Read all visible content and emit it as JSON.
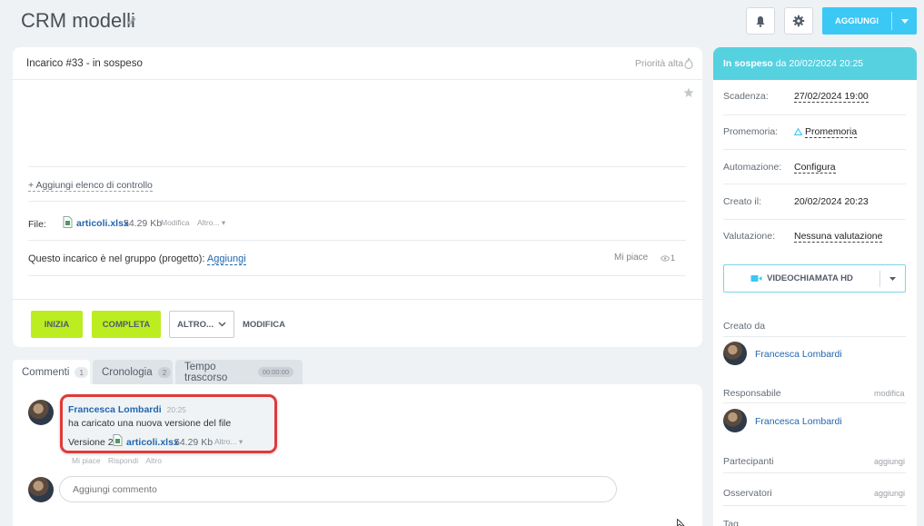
{
  "header": {
    "title": "CRM modelli",
    "add_label": "AGGIUNGI"
  },
  "task": {
    "title": "Incarico #33 - in sospeso",
    "priority_label": "Priorità alta",
    "checklist_link": "+ Aggiungi elenco di controllo",
    "file_label": "File:",
    "file_name": "articoli.xlsx",
    "file_size": "54.29 Kb",
    "file_edit": "Modifica",
    "file_more": "Altro...",
    "group_text": "Questo incarico è nel gruppo (progetto):",
    "group_link": "Aggiungi",
    "like_label": "Mi piace",
    "views": "1"
  },
  "actions": {
    "start": "INIZIA",
    "complete": "COMPLETA",
    "more": "ALTRO...",
    "edit": "MODIFICA"
  },
  "tabs": [
    {
      "label": "Commenti",
      "count": "1"
    },
    {
      "label": "Cronologia",
      "count": "2"
    },
    {
      "label": "Tempo trascorso",
      "count": "00:00:00"
    }
  ],
  "comment": {
    "author": "Francesca Lombardi",
    "time": "20:25",
    "text": "ha caricato una nuova versione del file",
    "version_label": "Versione 2:",
    "file_name": "articoli.xlsx",
    "file_size": "54.29 Kb",
    "file_more": "Altro...",
    "like": "Mi piace",
    "reply": "Rispondi",
    "more": "Altro"
  },
  "comment_input": {
    "placeholder": "Aggiungi commento"
  },
  "sidebar": {
    "status_prefix": "In sospeso",
    "status_date": "da 20/02/2024 20:25",
    "deadline_label": "Scadenza:",
    "deadline_value": "27/02/2024 19:00",
    "reminder_label": "Promemoria:",
    "reminder_value": "Promemoria",
    "automation_label": "Automazione:",
    "automation_value": "Configura",
    "created_label": "Creato il:",
    "created_value": "20/02/2024 20:23",
    "rating_label": "Valutazione:",
    "rating_value": "Nessuna valutazione",
    "video_call": "VIDEOCHIAMATA HD",
    "created_by_label": "Creato da",
    "created_by": "Francesca Lombardi",
    "responsible_label": "Responsabile",
    "responsible_action": "modifica",
    "responsible": "Francesca Lombardi",
    "participants_label": "Partecipanti",
    "participants_action": "aggiungi",
    "observers_label": "Osservatori",
    "observers_action": "aggiungi",
    "tags_label": "Tag"
  },
  "colors": {
    "accent": "#3bc8f5",
    "status_bar": "#56d1e0",
    "green_button": "#bbed21",
    "highlight_frame": "#e03a3a"
  }
}
